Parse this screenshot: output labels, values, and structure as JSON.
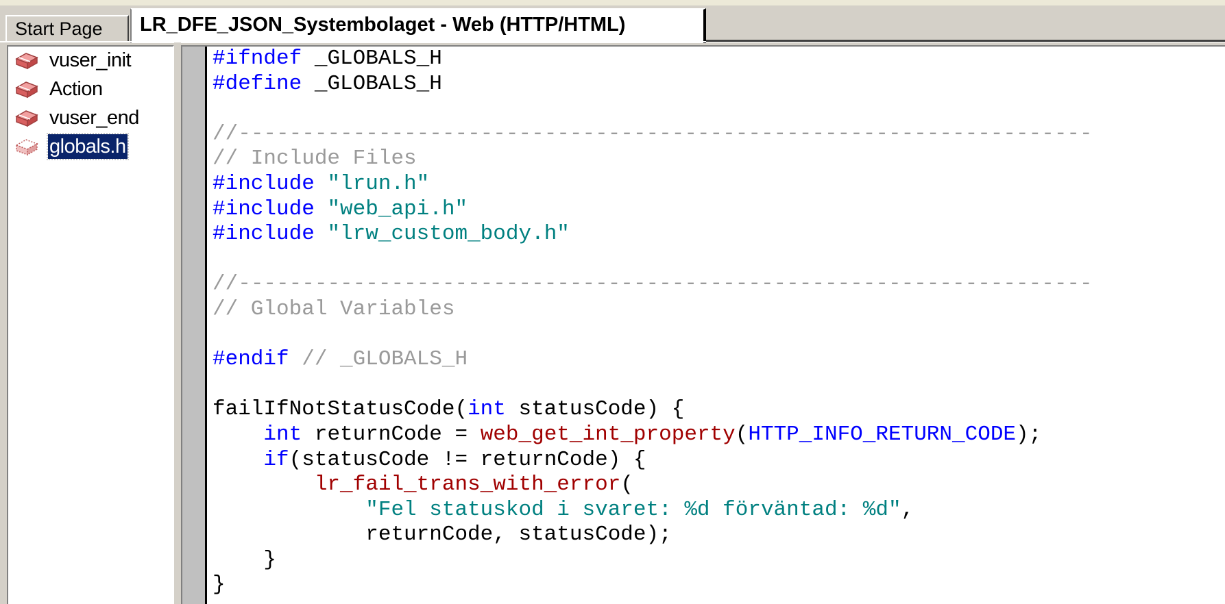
{
  "tabs": [
    {
      "label": "Start Page",
      "active": false
    },
    {
      "label": "LR_DFE_JSON_Systembolaget - Web (HTTP/HTML)",
      "active": true
    }
  ],
  "tree": {
    "items": [
      {
        "label": "vuser_init",
        "icon": "action-icon",
        "selected": false
      },
      {
        "label": "Action",
        "icon": "action-icon",
        "selected": false
      },
      {
        "label": "vuser_end",
        "icon": "action-icon",
        "selected": false
      },
      {
        "label": "globals.h",
        "icon": "header-file-icon",
        "selected": true
      }
    ]
  },
  "editor": {
    "lines": [
      [
        {
          "t": "#ifndef",
          "c": "kw"
        },
        {
          "t": " _GLOBALS_H",
          "c": "plain"
        }
      ],
      [
        {
          "t": "#define",
          "c": "kw"
        },
        {
          "t": " _GLOBALS_H",
          "c": "plain"
        }
      ],
      [],
      [
        {
          "t": "//",
          "c": "cmt"
        },
        {
          "t": "-------------------------------------------------------------------",
          "c": "cmt"
        }
      ],
      [
        {
          "t": "// Include Files",
          "c": "cmt"
        }
      ],
      [
        {
          "t": "#include",
          "c": "kw"
        },
        {
          "t": " ",
          "c": "plain"
        },
        {
          "t": "\"lrun.h\"",
          "c": "str"
        }
      ],
      [
        {
          "t": "#include",
          "c": "kw"
        },
        {
          "t": " ",
          "c": "plain"
        },
        {
          "t": "\"web_api.h\"",
          "c": "str"
        }
      ],
      [
        {
          "t": "#include",
          "c": "kw"
        },
        {
          "t": " ",
          "c": "plain"
        },
        {
          "t": "\"lrw_custom_body.h\"",
          "c": "str"
        }
      ],
      [],
      [
        {
          "t": "//",
          "c": "cmt"
        },
        {
          "t": "-------------------------------------------------------------------",
          "c": "cmt"
        }
      ],
      [
        {
          "t": "// Global Variables",
          "c": "cmt"
        }
      ],
      [],
      [
        {
          "t": "#endif",
          "c": "kw"
        },
        {
          "t": " // _GLOBALS_H",
          "c": "cmt"
        }
      ],
      [],
      [
        {
          "t": "failIfNotStatusCode(",
          "c": "plain"
        },
        {
          "t": "int",
          "c": "kw"
        },
        {
          "t": " statusCode) {",
          "c": "plain"
        }
      ],
      [
        {
          "t": "    ",
          "c": "plain"
        },
        {
          "t": "int",
          "c": "kw"
        },
        {
          "t": " returnCode = ",
          "c": "plain"
        },
        {
          "t": "web_get_int_property",
          "c": "fn"
        },
        {
          "t": "(",
          "c": "plain"
        },
        {
          "t": "HTTP_INFO_RETURN_CODE",
          "c": "const"
        },
        {
          "t": ");",
          "c": "plain"
        }
      ],
      [
        {
          "t": "    ",
          "c": "plain"
        },
        {
          "t": "if",
          "c": "kw"
        },
        {
          "t": "(statusCode != returnCode) {",
          "c": "plain"
        }
      ],
      [
        {
          "t": "        ",
          "c": "plain"
        },
        {
          "t": "lr_fail_trans_with_error",
          "c": "fn"
        },
        {
          "t": "(",
          "c": "plain"
        }
      ],
      [
        {
          "t": "            ",
          "c": "plain"
        },
        {
          "t": "\"Fel statuskod i svaret: %d förväntad: %d\"",
          "c": "str"
        },
        {
          "t": ",",
          "c": "plain"
        }
      ],
      [
        {
          "t": "            returnCode, statusCode);",
          "c": "plain"
        }
      ],
      [
        {
          "t": "    }",
          "c": "plain"
        }
      ],
      [
        {
          "t": "}",
          "c": "plain"
        }
      ]
    ]
  },
  "colors": {
    "keyword": "#0000ff",
    "string": "#008080",
    "comment": "#9a9a9a",
    "function": "#a00000",
    "selection": "#0a246a",
    "chrome": "#d4d0c8"
  }
}
